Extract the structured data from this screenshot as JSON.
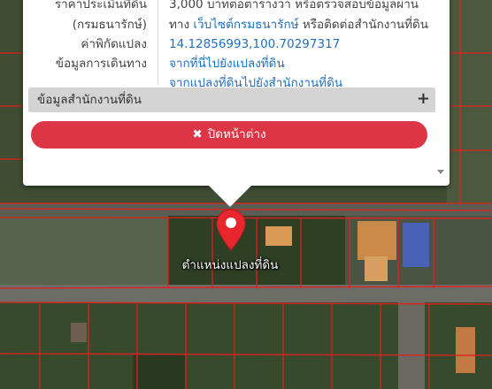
{
  "info": {
    "rows": [
      {
        "label": "ราคาประเมินที่ดิน",
        "value_plain": "3,000 บาทต่อตารางวา หรือตรวจสอบข้อมูลผ่าน"
      },
      {
        "label": "(กรมธนารักษ์)",
        "value_prefix": "ทาง ",
        "value_link": "เว็บไซต์กรมธนารักษ์",
        "value_suffix": " หรือติดต่อสำนักงานที่ดิน"
      },
      {
        "label": "ค่าพิกัดแปลง",
        "value_link": "14.12856993,100.70297317"
      },
      {
        "label": "ข้อมูลการเดินทาง",
        "value_link": "จากที่นี่ไปยังแปลงที่ดิน"
      },
      {
        "label": "",
        "value_link": "จากแปลงที่ดินไปยังสำนักงานที่ดิน"
      }
    ]
  },
  "accordion": {
    "label": "ข้อมูลสำนักงานที่ดิน",
    "icon": "plus-icon"
  },
  "close_button": {
    "label": "ปิดหน้าต่าง",
    "icon": "x-icon"
  },
  "marker": {
    "label": "ตำแหน่งแปลงที่ดิน",
    "color": "#e8262d"
  },
  "colors": {
    "button": "#dc3545",
    "link": "#1f6fbf",
    "parcel_lines": "#e02020"
  }
}
